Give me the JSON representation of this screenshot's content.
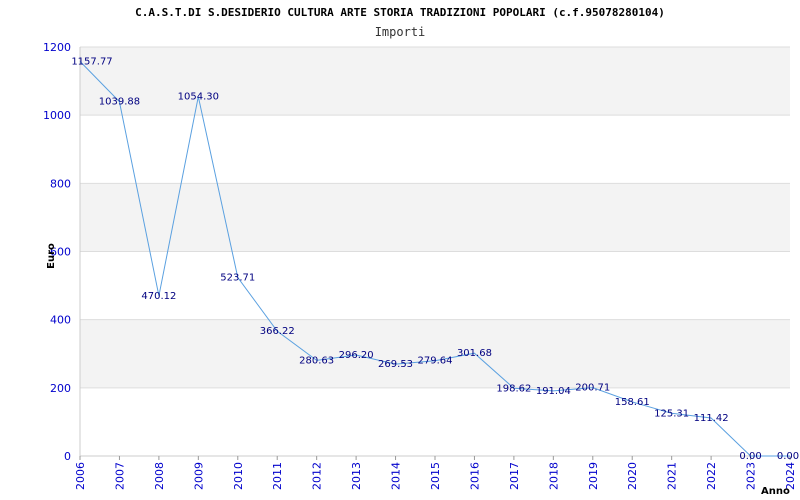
{
  "chart_data": {
    "type": "line",
    "title": "C.A.S.T.DI S.DESIDERIO CULTURA ARTE STORIA TRADIZIONI POPOLARI (c.f.95078280104)",
    "subtitle": "Importi",
    "ylabel": "Euro",
    "xlabel": "Anno",
    "ylim": [
      0,
      1200
    ],
    "yticks": [
      "0",
      "200",
      "400",
      "600",
      "800",
      "1000",
      "1200"
    ],
    "x": [
      "2006",
      "2007",
      "2008",
      "2009",
      "2010",
      "2011",
      "2012",
      "2013",
      "2014",
      "2015",
      "2016",
      "2017",
      "2018",
      "2019",
      "2020",
      "2021",
      "2022",
      "2023",
      "2024"
    ],
    "values": [
      1157.77,
      1039.88,
      470.12,
      1054.3,
      523.71,
      366.22,
      280.63,
      296.2,
      269.53,
      279.64,
      301.68,
      198.62,
      191.04,
      200.71,
      158.61,
      125.31,
      111.42,
      0.0,
      0.0
    ],
    "labels": [
      "1157.77",
      "1039.88",
      "470.12",
      "1054.30",
      "523.71",
      "366.22",
      "280.63",
      "296.20",
      "269.53",
      "279.64",
      "301.68",
      "198.62",
      "191.04",
      "200.71",
      "158.61",
      "125.31",
      "111.42",
      "0.00",
      "0.00"
    ],
    "grid": true,
    "line_color": "#5aa0e0",
    "band_color": "#f3f3f3",
    "tick_color": "#0000cc",
    "label_color": "#000080"
  }
}
